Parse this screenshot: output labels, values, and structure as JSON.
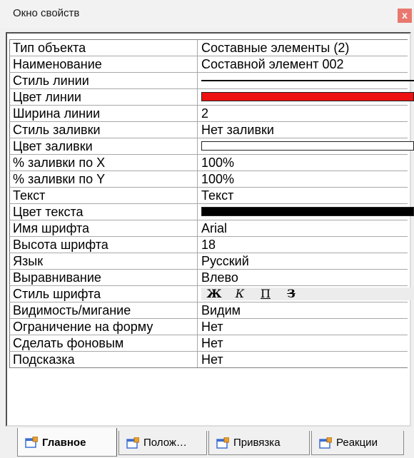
{
  "window": {
    "title": "Окно свойств",
    "close_label": "x"
  },
  "properties": [
    {
      "name": "Тип объекта",
      "value": "Составные элементы (2)",
      "kind": "text"
    },
    {
      "name": "Наименование",
      "value": "Составной элемент 002",
      "kind": "text"
    },
    {
      "name": "Стиль  линии",
      "value": "",
      "kind": "line"
    },
    {
      "name": "Цвет   линии",
      "value": "",
      "kind": "color",
      "color": "#ee1111"
    },
    {
      "name": "Ширина линии",
      "value": "2",
      "kind": "text"
    },
    {
      "name": "Стиль заливки",
      "value": "Нет заливки",
      "kind": "text"
    },
    {
      "name": "Цвет  заливки",
      "value": "",
      "kind": "color",
      "color": "#ffffff"
    },
    {
      "name": "% заливки по X",
      "value": "100%",
      "kind": "text"
    },
    {
      "name": "% заливки по Y",
      "value": "100%",
      "kind": "text"
    },
    {
      "name": "Текст",
      "value": "Текст",
      "kind": "text"
    },
    {
      "name": "Цвет текста",
      "value": "",
      "kind": "color",
      "color": "#000000"
    },
    {
      "name": "Имя шрифта",
      "value": "Arial",
      "kind": "text"
    },
    {
      "name": "Высота шрифта",
      "value": "18",
      "kind": "text"
    },
    {
      "name": "Язык",
      "value": "Русский",
      "kind": "text"
    },
    {
      "name": "Выравнивание",
      "value": "Влево",
      "kind": "text"
    },
    {
      "name": "Стиль шрифта",
      "value": "",
      "kind": "fontstyle"
    },
    {
      "name": "Видимость/мигание",
      "value": "Видим",
      "kind": "text"
    },
    {
      "name": "Ограничение на форму",
      "value": "Нет",
      "kind": "text"
    },
    {
      "name": "Сделать фоновым",
      "value": "Нет",
      "kind": "text"
    },
    {
      "name": "Подсказка",
      "value": "Нет",
      "kind": "text"
    }
  ],
  "font_style_buttons": [
    "Ж",
    "К",
    "П",
    "З"
  ],
  "tabs": [
    {
      "label": "Главное",
      "active": true
    },
    {
      "label": "Полож…",
      "active": false
    },
    {
      "label": "Привязка",
      "active": false
    },
    {
      "label": "Реакции",
      "active": false
    }
  ],
  "colors": {
    "close": "#e8786e",
    "icon_blue": "#3c6fd0",
    "icon_orange": "#e8a030"
  }
}
